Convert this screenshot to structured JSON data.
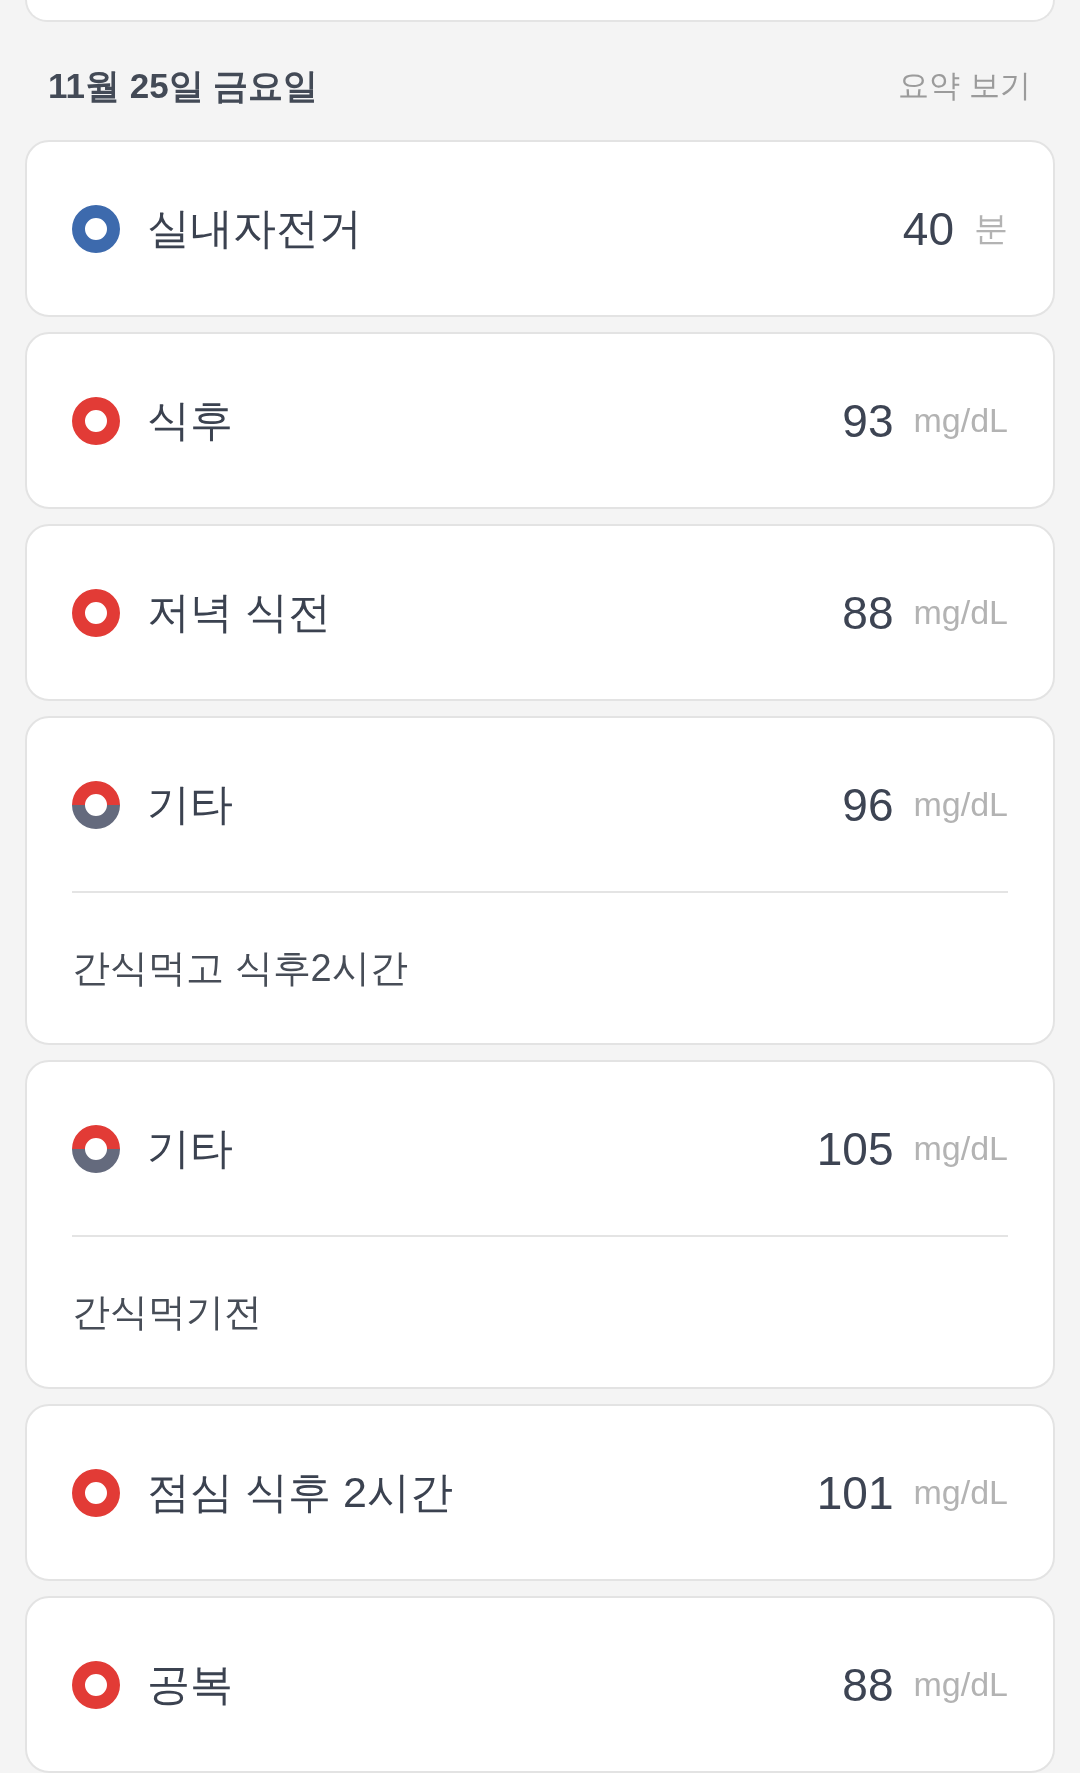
{
  "date_header": {
    "title": "11월 25일 금요일",
    "summary_link": "요약 보기"
  },
  "entries": [
    {
      "name": "실내자전거",
      "value": "40",
      "unit": "분",
      "ring_segments": [
        {
          "color": "#3d6aad"
        }
      ]
    },
    {
      "name": "식후",
      "value": "93",
      "unit": "mg/dL",
      "ring_segments": [
        {
          "color": "#e23b36"
        }
      ]
    },
    {
      "name": "저녁 식전",
      "value": "88",
      "unit": "mg/dL",
      "ring_segments": [
        {
          "color": "#e23b36"
        }
      ]
    },
    {
      "name": "기타",
      "value": "96",
      "unit": "mg/dL",
      "ring_segments": [
        {
          "color": "#e23b36"
        },
        {
          "color": "#646a7d"
        }
      ],
      "note": "간식먹고 식후2시간"
    },
    {
      "name": "기타",
      "value": "105",
      "unit": "mg/dL",
      "ring_segments": [
        {
          "color": "#e23b36"
        },
        {
          "color": "#646a7d"
        }
      ],
      "note": "간식먹기전"
    },
    {
      "name": "점심 식후 2시간",
      "value": "101",
      "unit": "mg/dL",
      "ring_segments": [
        {
          "color": "#e23b36"
        }
      ]
    },
    {
      "name": "공복",
      "value": "88",
      "unit": "mg/dL",
      "ring_segments": [
        {
          "color": "#e23b36"
        }
      ]
    }
  ]
}
